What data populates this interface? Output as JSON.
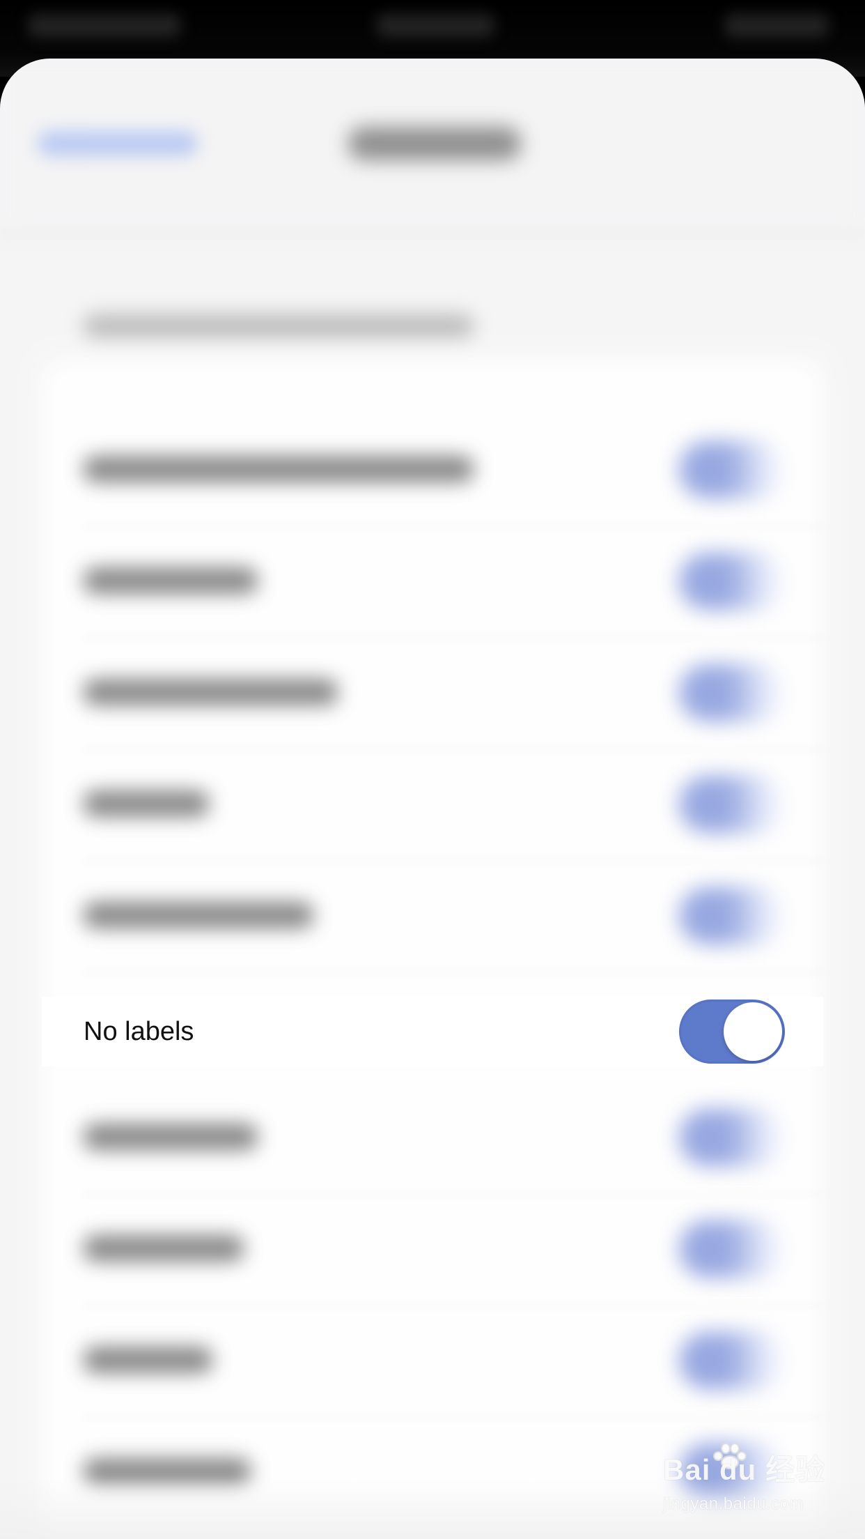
{
  "active_setting": {
    "label": "No labels",
    "toggle_on": true
  },
  "watermark": {
    "brand": "Bai du 经验",
    "url": "jingyan.baidu.com"
  },
  "colors": {
    "toggle_accent": "#5e7acb",
    "screen_background": "#f5f5f6"
  },
  "icons": {
    "toggle": "toggle-switch-icon",
    "watermark": "paw-icon"
  }
}
